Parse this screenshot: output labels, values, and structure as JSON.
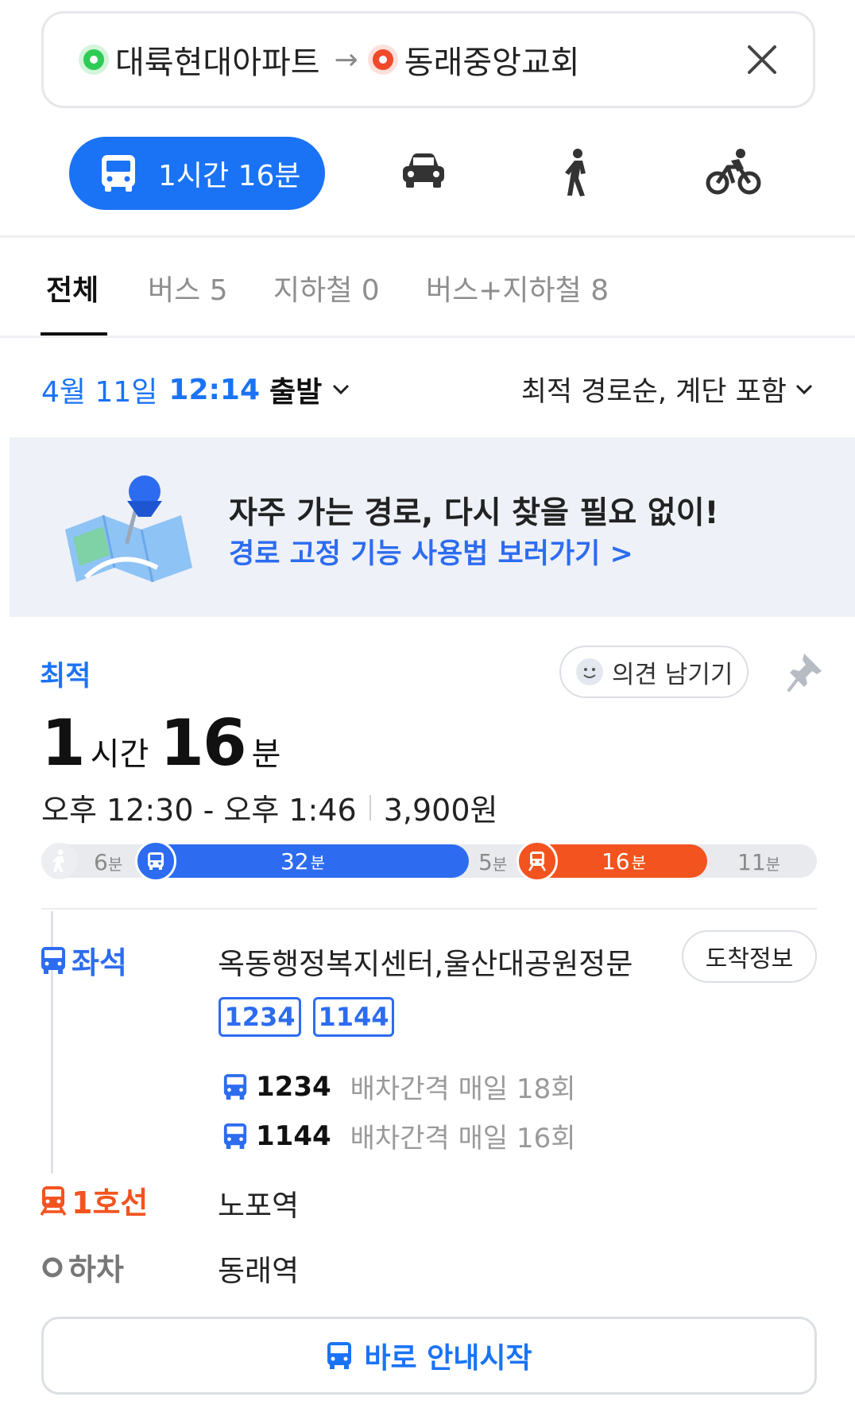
{
  "search": {
    "origin": "대륙현대아파트",
    "arrow": "→",
    "destination": "동래중앙교회"
  },
  "modes": {
    "transit_time": "1시간 16분"
  },
  "categories": [
    {
      "label": "전체"
    },
    {
      "label": "버스 5"
    },
    {
      "label": "지하철 0"
    },
    {
      "label": "버스+지하철 8"
    }
  ],
  "time_filter": {
    "date": "4월 11일",
    "time": "12:14",
    "departure": "출발"
  },
  "sort": {
    "label": "최적 경로순, 계단 포함"
  },
  "banner": {
    "title": "자주 가는 경로, 다시 찾을 필요 없이!",
    "link": "경로 고정 기능 사용법 보러가기 >"
  },
  "route": {
    "tag": "최적",
    "hours": "1",
    "hours_unit": "시간",
    "minutes": "16",
    "minutes_unit": "분",
    "time_range": "오후 12:30 - 오후 1:46",
    "fare": "3,900원",
    "opinion_label": "의견 남기기",
    "segments": {
      "walk1": "6",
      "bus": "32",
      "transfer": "5",
      "subway": "16",
      "walk2": "11",
      "unit": "분"
    },
    "steps": {
      "board_label": "좌석",
      "board_stop": "옥동행정복지센터,울산대공원정문",
      "arrival_info": "도착정보",
      "bus_numbers": [
        "1234",
        "1144"
      ],
      "frequencies": [
        {
          "bus": "1234",
          "info": "배차간격 매일 18회"
        },
        {
          "bus": "1144",
          "info": "배차간격 매일 16회"
        }
      ],
      "subway_label": "1호선",
      "subway_stop": "노포역",
      "alight_label": "하차",
      "alight_stop": "동래역"
    },
    "start_button": "바로 안내시작"
  },
  "colors": {
    "accent": "#1a73f5",
    "bus": "#2d6cf0",
    "subway": "#f3541f",
    "origin": "#2ecc55",
    "destination": "#f04a2c"
  }
}
